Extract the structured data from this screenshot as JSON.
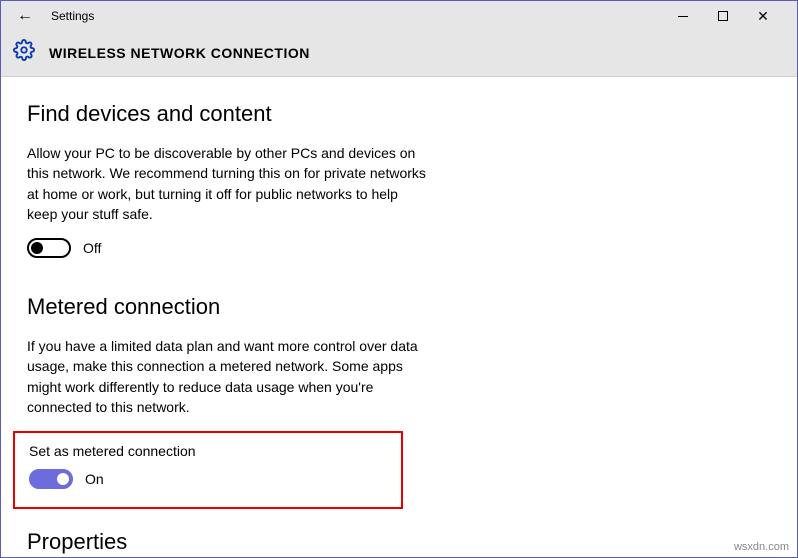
{
  "window": {
    "app_title": "Settings"
  },
  "header": {
    "page_heading": "WIRELESS NETWORK CONNECTION"
  },
  "sections": {
    "find": {
      "title": "Find devices and content",
      "body": "Allow your PC to be discoverable by other PCs and devices on this network. We recommend turning this on for private networks at home or work, but turning it off for public networks to help keep your stuff safe.",
      "toggle_state": "Off"
    },
    "metered": {
      "title": "Metered connection",
      "body": "If you have a limited data plan and want more control over data usage, make this connection a metered network. Some apps might work differently to reduce data usage when you're connected to this network.",
      "sublabel": "Set as metered connection",
      "toggle_state": "On"
    },
    "properties": {
      "title": "Properties"
    }
  },
  "watermark": "wsxdn.com"
}
